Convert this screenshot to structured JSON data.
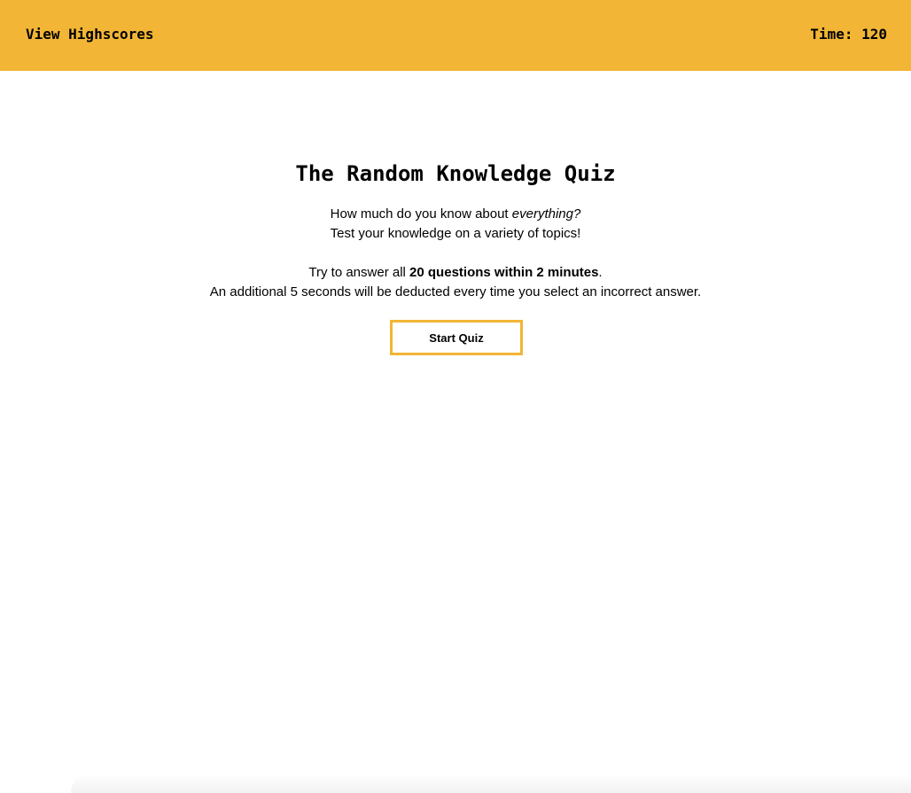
{
  "header": {
    "highscores_label": "View Highscores",
    "timer_label": "Time: ",
    "timer_value": "120"
  },
  "quiz": {
    "title": "The Random Knowledge Quiz",
    "intro_line1_prefix": "How much do you know about ",
    "intro_line1_emphasis": "everything?",
    "intro_line2": "Test your knowledge on a variety of topics!",
    "rules_line1_prefix": "Try to answer all ",
    "rules_line1_bold": "20 questions within 2 minutes",
    "rules_line1_suffix": ".",
    "rules_line2": "An additional 5 seconds will be deducted every time you select an incorrect answer.",
    "start_button_label": "Start Quiz"
  },
  "colors": {
    "accent": "#f2b535",
    "background": "#ffffff",
    "text": "#000000"
  }
}
